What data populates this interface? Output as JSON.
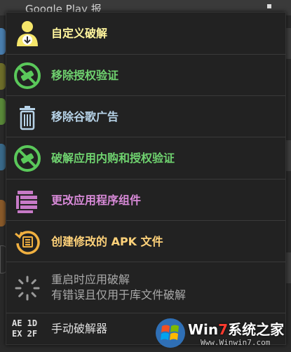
{
  "background": {
    "header_title": "Google Play 报",
    "accent": "#f0a030"
  },
  "menu": {
    "items": [
      {
        "label": "自定义破解",
        "color": "#fff59d",
        "icon": "user-download-icon"
      },
      {
        "label": "移除授权验证",
        "color": "#6fd26f",
        "icon": "no-license-icon"
      },
      {
        "label": "移除谷歌广告",
        "color": "#b7d3e8",
        "icon": "trash-icon"
      },
      {
        "label": "破解应用内购和授权验证",
        "color": "#6fd26f",
        "icon": "no-purchase-icon"
      },
      {
        "label": "更改应用程序组件",
        "color": "#d88ad8",
        "icon": "components-icon"
      },
      {
        "label": "创建修改的 APK 文件",
        "color": "#ffd27a",
        "icon": "apk-history-icon"
      },
      {
        "label": "重启时应用破解",
        "label2": "有错误且仅用于库文件破解",
        "color": "#aaaaaa",
        "icon": "loading-icon"
      },
      {
        "label": "手动破解器",
        "color": "#e0e0e0",
        "icon": "hex-code-icon",
        "icon_text": "AE 1D EX 2F"
      }
    ]
  },
  "watermark": {
    "brand_win": "Win",
    "brand_num": "7",
    "brand_rest": "系统之家",
    "url": "Www.Winwin7.com"
  }
}
